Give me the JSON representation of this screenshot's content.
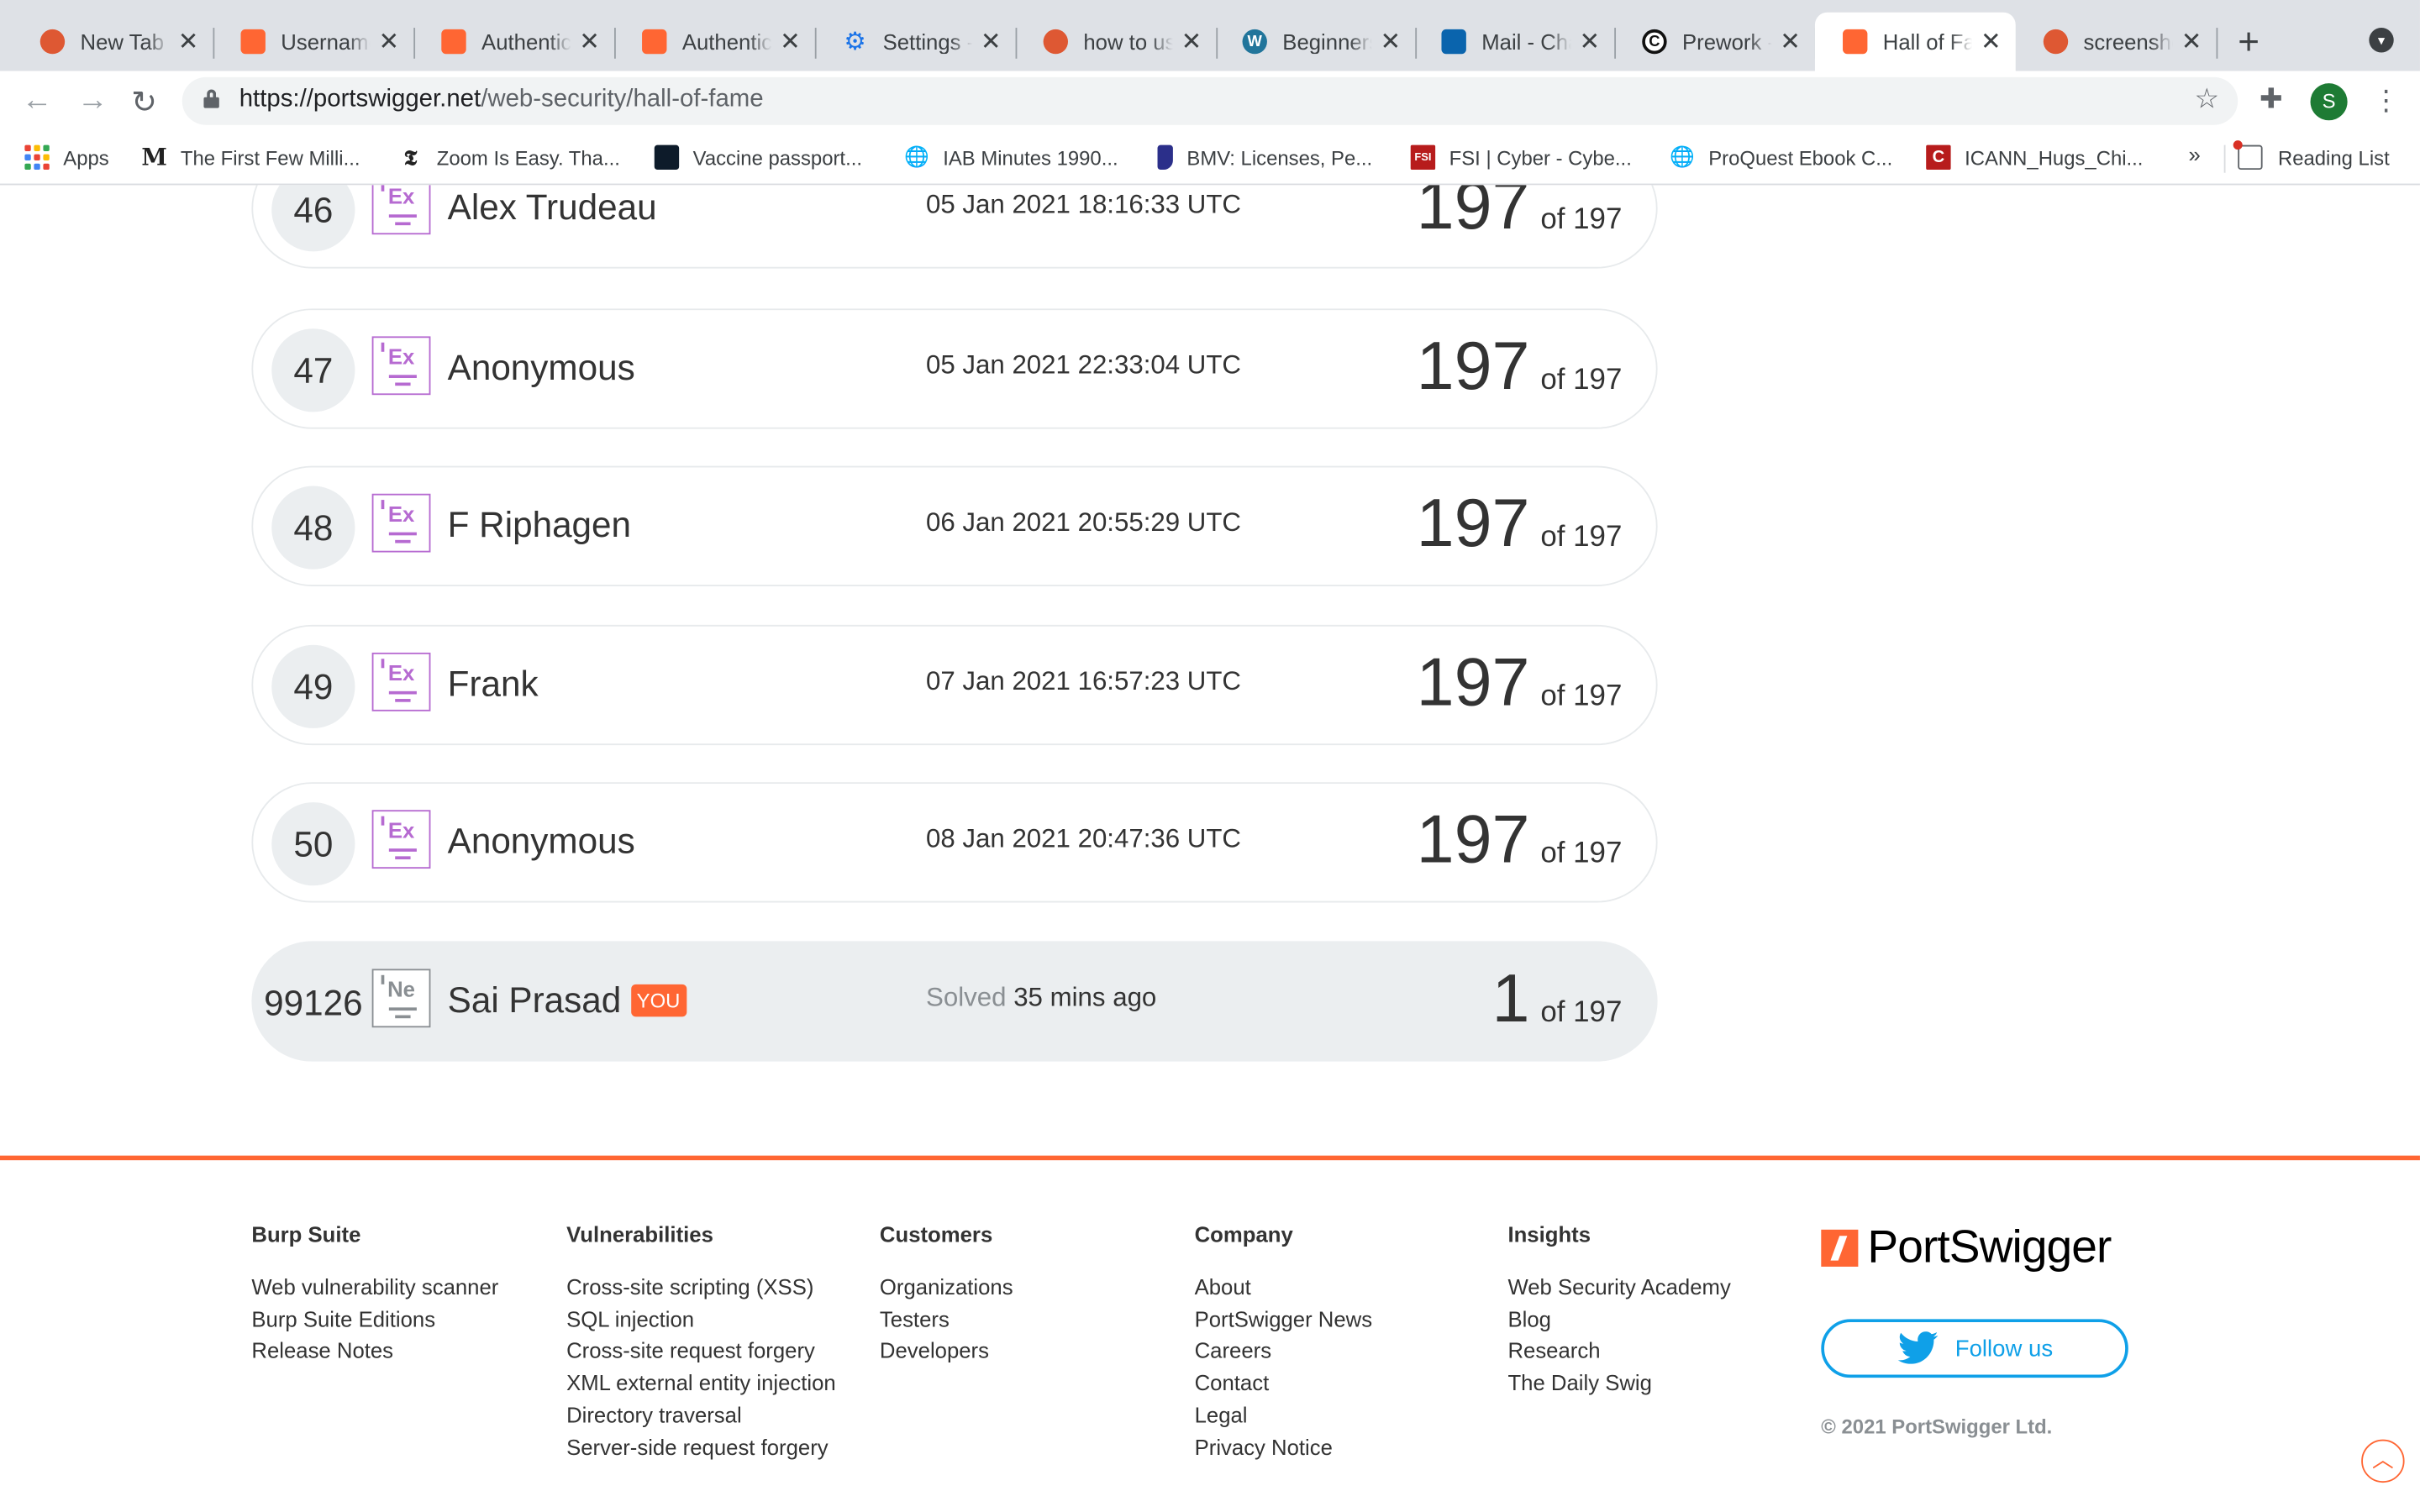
{
  "browser": {
    "tabs": [
      {
        "title": "New Tab",
        "favicon": "duckduckgo-icon"
      },
      {
        "title": "Username",
        "favicon": "portswigger-icon"
      },
      {
        "title": "Authentic",
        "favicon": "portswigger-icon"
      },
      {
        "title": "Authentic",
        "favicon": "portswigger-icon"
      },
      {
        "title": "Settings -",
        "favicon": "gear-icon"
      },
      {
        "title": "how to us",
        "favicon": "duckduckgo-icon"
      },
      {
        "title": "Beginners",
        "favicon": "wordpress-icon"
      },
      {
        "title": "Mail - Cha",
        "favicon": "outlook-icon"
      },
      {
        "title": "Prework -",
        "favicon": "codepath-icon"
      },
      {
        "title": "Hall of Fa",
        "favicon": "portswigger-icon"
      },
      {
        "title": "screensho",
        "favicon": "duckduckgo-icon"
      }
    ],
    "tab_close_glyph": "✕",
    "new_tab_glyph": "+",
    "url_host": "https://portswigger.net",
    "url_path": "/web-security/hall-of-fame",
    "profile_initial": "S",
    "bookmarks": [
      {
        "label": "Apps"
      },
      {
        "label": "The First Few Milli...",
        "icon": "M"
      },
      {
        "label": "Zoom Is Easy. Tha...",
        "icon": "𝕿"
      },
      {
        "label": "Vaccine passport..."
      },
      {
        "label": "IAB Minutes 1990..."
      },
      {
        "label": "BMV: Licenses, Pe..."
      },
      {
        "label": "FSI | Cyber - Cybe...",
        "icon": "FSI"
      },
      {
        "label": "ProQuest Ebook C..."
      },
      {
        "label": "ICANN_Hugs_Chi...",
        "icon": "C"
      }
    ],
    "bookmarks_overflow": "»",
    "reading_list": "Reading List"
  },
  "leaderboard": {
    "rows": [
      {
        "rank": "46",
        "level_abbr": "Ex",
        "name": "Alex Trudeau",
        "timestamp": "05 Jan 2021 18:16:33 UTC",
        "solved": "197",
        "total": "of 197"
      },
      {
        "rank": "47",
        "level_abbr": "Ex",
        "name": "Anonymous",
        "timestamp": "05 Jan 2021 22:33:04 UTC",
        "solved": "197",
        "total": "of 197"
      },
      {
        "rank": "48",
        "level_abbr": "Ex",
        "name": "F Riphagen",
        "timestamp": "06 Jan 2021 20:55:29 UTC",
        "solved": "197",
        "total": "of 197"
      },
      {
        "rank": "49",
        "level_abbr": "Ex",
        "name": "Frank",
        "timestamp": "07 Jan 2021 16:57:23 UTC",
        "solved": "197",
        "total": "of 197"
      },
      {
        "rank": "50",
        "level_abbr": "Ex",
        "name": "Anonymous",
        "timestamp": "08 Jan 2021 20:47:36 UTC",
        "solved": "197",
        "total": "of 197"
      }
    ],
    "you": {
      "rank": "99126",
      "level_abbr": "Ne",
      "name": "Sai Prasad",
      "badge": "YOU",
      "solved_label": "Solved",
      "solved_when": "35 mins ago",
      "solved": "1",
      "total": "of 197"
    }
  },
  "footer": {
    "columns": [
      {
        "heading": "Burp Suite",
        "links": [
          "Web vulnerability scanner",
          "Burp Suite Editions",
          "Release Notes"
        ]
      },
      {
        "heading": "Vulnerabilities",
        "links": [
          "Cross-site scripting (XSS)",
          "SQL injection",
          "Cross-site request forgery",
          "XML external entity injection",
          "Directory traversal",
          "Server-side request forgery"
        ]
      },
      {
        "heading": "Customers",
        "links": [
          "Organizations",
          "Testers",
          "Developers"
        ]
      },
      {
        "heading": "Company",
        "links": [
          "About",
          "PortSwigger News",
          "Careers",
          "Contact",
          "Legal",
          "Privacy Notice"
        ]
      },
      {
        "heading": "Insights",
        "links": [
          "Web Security Academy",
          "Blog",
          "Research",
          "The Daily Swig"
        ]
      }
    ],
    "brand": "PortSwigger",
    "follow_label": "Follow us",
    "copyright": "© 2021 PortSwigger Ltd."
  },
  "colors": {
    "accent": "#ff6633",
    "expert": "#b66ad1",
    "twitter": "#0fa0e8",
    "row_bg": "#ebeef0"
  }
}
